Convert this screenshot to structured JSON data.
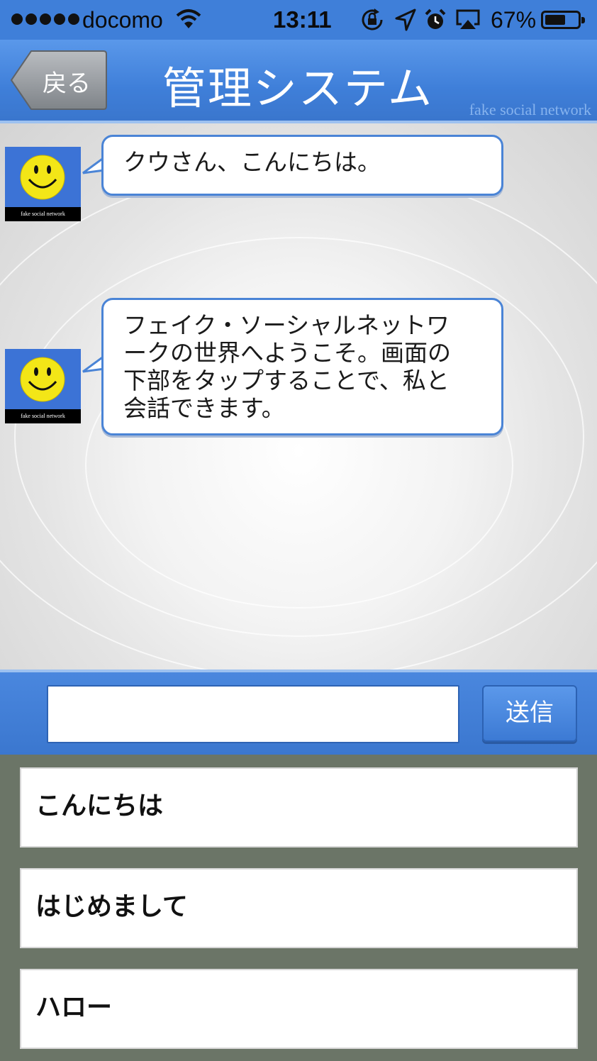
{
  "status_bar": {
    "carrier": "docomo",
    "time": "13:11",
    "battery_percent": "67%",
    "battery_level": 0.67,
    "icons": [
      "signal-dots-icon",
      "wifi-icon",
      "orientation-lock-icon",
      "location-arrow-icon",
      "alarm-icon",
      "airplay-icon",
      "battery-icon"
    ]
  },
  "header": {
    "back_label": "戻る",
    "title": "管理システム",
    "watermark": "fake social network"
  },
  "messages": [
    {
      "avatar_caption": "fake social network",
      "text": "クウさん、こんにちは。"
    },
    {
      "avatar_caption": "fake social network",
      "lines": [
        "フェイク・ソーシャルネットワ",
        "ークの世界へようこそ。画面の",
        "下部をタップすることで、私と",
        "会話できます。"
      ]
    }
  ],
  "input": {
    "value": "",
    "send_label": "送信"
  },
  "quick_replies": [
    "こんにちは",
    "はじめまして",
    "ハロー"
  ],
  "colors": {
    "header_blue": "#3f7fd9",
    "bubble_border": "#4a84d6",
    "reply_area_bg": "#6b7567"
  }
}
